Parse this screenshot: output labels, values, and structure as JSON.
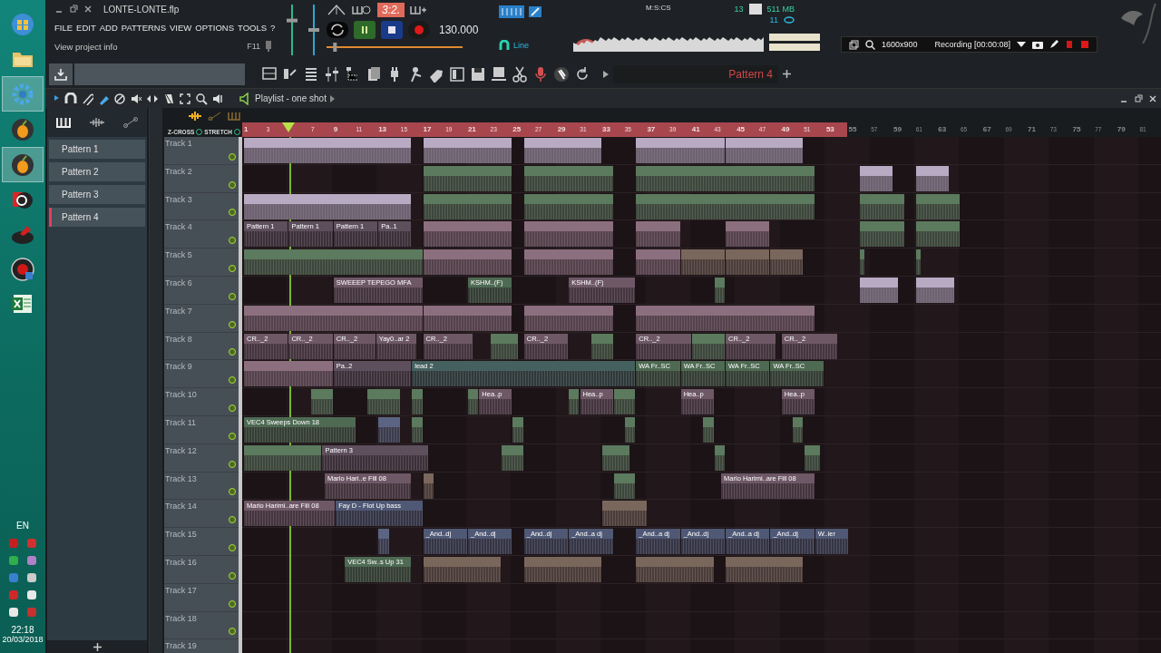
{
  "taskbar": {
    "language": "EN",
    "time": "22:18",
    "date": "20/03/2018"
  },
  "window": {
    "title": "LONTE-LONTE.flp"
  },
  "menu": [
    "FILE",
    "EDIT",
    "ADD",
    "PATTERNS",
    "VIEW",
    "OPTIONS",
    "TOOLS",
    "?"
  ],
  "hint": {
    "text": "View project info",
    "shortcut": "F11"
  },
  "mixer": {
    "volume": {
      "level": 0.7
    },
    "pitch": {
      "level": 0.5
    }
  },
  "transport": {
    "song_position": "3:2.",
    "playing": true,
    "tempo": "130.000",
    "snap": "Line",
    "position_slider": {
      "level": 0.05
    }
  },
  "monitor": {
    "time_format": "M:S:CS",
    "cpu": "13",
    "memory": "511 MB",
    "polyphony": "11"
  },
  "pattern_selector": {
    "value": "Pattern 4"
  },
  "recorder": {
    "resolution": "1600x900",
    "status": "Recording [00:00:08]"
  },
  "playlist": {
    "title": "Playlist - one shot",
    "z_cross": "Z-CROSS",
    "stretch": "STRETCH",
    "patterns": [
      {
        "label": "Pattern 1",
        "selected": false
      },
      {
        "label": "Pattern 2",
        "selected": false
      },
      {
        "label": "Pattern 3",
        "selected": false
      },
      {
        "label": "Pattern 4",
        "selected": true
      }
    ],
    "ruler": {
      "song": [
        {
          "label": "1"
        },
        {
          "label": "3"
        },
        {
          "kind": "playhead"
        },
        {
          "label": "7"
        },
        {
          "label": "9"
        },
        {
          "label": "11"
        },
        {
          "label": "13"
        },
        {
          "label": "15"
        },
        {
          "label": "17"
        },
        {
          "label": "19"
        },
        {
          "label": "21"
        },
        {
          "label": "23"
        },
        {
          "label": "25"
        },
        {
          "label": "27"
        },
        {
          "label": "29"
        },
        {
          "label": "31"
        },
        {
          "label": "33"
        },
        {
          "label": "35"
        },
        {
          "label": "37"
        },
        {
          "label": "39"
        },
        {
          "label": "41"
        },
        {
          "label": "43"
        },
        {
          "label": "45"
        },
        {
          "label": "47"
        },
        {
          "label": "49"
        },
        {
          "label": "51"
        },
        {
          "label": "53"
        }
      ],
      "after": [
        {
          "label": "55"
        },
        {
          "label": "57"
        },
        {
          "label": "59"
        },
        {
          "label": "61"
        },
        {
          "label": "63"
        },
        {
          "label": "65"
        },
        {
          "label": "67"
        },
        {
          "label": "69"
        },
        {
          "label": "71"
        },
        {
          "label": "73"
        },
        {
          "label": "75"
        },
        {
          "label": "77"
        },
        {
          "label": "79"
        },
        {
          "label": "81"
        }
      ]
    },
    "tracks": [
      {
        "name": "Track 1",
        "enabled": true,
        "clips": [
          {
            "color": "#b9aac4"
          },
          {
            "color": "#b9aac4"
          },
          {
            "color": "#b9aac4"
          },
          {
            "color": "#b9aac4"
          },
          {
            "color": "#b9aac4"
          }
        ]
      },
      {
        "name": "Track 2",
        "enabled": true,
        "clips": [
          {
            "color": "#5c7a5e"
          },
          {
            "color": "#5c7a5e"
          },
          {
            "color": "#5c7a5e"
          },
          {
            "color": "#b9aac4"
          },
          {
            "color": "#b9aac4"
          }
        ]
      },
      {
        "name": "Track 3",
        "enabled": true,
        "clips": [
          {
            "color": "#b9aac4"
          },
          {
            "color": "#5c7a5e"
          },
          {
            "color": "#5c7a5e"
          },
          {
            "color": "#5c7a5e"
          },
          {
            "color": "#5c7a5e"
          },
          {
            "color": "#5c7a5e"
          }
        ]
      },
      {
        "name": "Track 4",
        "enabled": true,
        "clips": [
          {
            "color": "#5e4f5d",
            "label": "Pattern 1"
          },
          {
            "color": "#5e4f5d",
            "label": "Pattern 1"
          },
          {
            "color": "#5e4f5d",
            "label": "Pattern 1"
          },
          {
            "color": "#5e4f5d",
            "label": "Pa..1"
          },
          {
            "color": "#8c6f7e"
          },
          {
            "color": "#8c6f7e"
          },
          {
            "color": "#8c6f7e"
          },
          {
            "color": "#8c6f7e"
          },
          {
            "color": "#5c7a5e"
          },
          {
            "color": "#5c7a5e"
          }
        ]
      },
      {
        "name": "Track 5",
        "enabled": true,
        "clips": [
          {
            "color": "#5c7a5e"
          },
          {
            "color": "#8c6f7e"
          },
          {
            "color": "#8c6f7e"
          },
          {
            "color": "#8c6f7e"
          },
          {
            "color": "#7a675c"
          },
          {
            "color": "#7a675c"
          },
          {
            "color": "#7a675c"
          },
          {
            "color": "#5c7a5e"
          },
          {
            "color": "#5c7a5e"
          }
        ]
      },
      {
        "name": "Track 6",
        "enabled": true,
        "clips": [
          {
            "color": "#6e5866",
            "label": "SWEEEP TEPEGO MFA"
          },
          {
            "color": "#4e6a53",
            "label": "KSHM..(F)"
          },
          {
            "color": "#6e5866",
            "label": "KSHM..(F)"
          },
          {
            "color": "#5c7a5e"
          },
          {
            "color": "#b9aac4"
          },
          {
            "color": "#b9aac4"
          }
        ]
      },
      {
        "name": "Track 7",
        "enabled": true,
        "clips": [
          {
            "color": "#8c6f7e"
          },
          {
            "color": "#8c6f7e"
          },
          {
            "color": "#8c6f7e"
          },
          {
            "color": "#8c6f7e"
          }
        ]
      },
      {
        "name": "Track 8",
        "enabled": true,
        "clips": [
          {
            "color": "#6e5866",
            "label": "CR.._2"
          },
          {
            "color": "#6e5866",
            "label": "CR.._2"
          },
          {
            "color": "#6e5866",
            "label": "CR.._2"
          },
          {
            "color": "#6e5866",
            "label": "Yay0..ar 2"
          },
          {
            "color": "#6e5866",
            "label": "CR.._2"
          },
          {
            "color": "#5c7a5e"
          },
          {
            "color": "#6e5866",
            "label": "CR.._2"
          },
          {
            "color": "#5c7a5e"
          },
          {
            "color": "#6e5866",
            "label": "CR.._2"
          },
          {
            "color": "#5c7a5e"
          },
          {
            "color": "#6e5866",
            "label": "CR.._2"
          },
          {
            "color": "#6e5866",
            "label": "CR.._2"
          }
        ]
      },
      {
        "name": "Track 9",
        "enabled": true,
        "clips": [
          {
            "color": "#8c6f7e"
          },
          {
            "color": "#5e4f5d",
            "label": "Pa..2"
          },
          {
            "color": "#44605f",
            "label": "lead 2"
          },
          {
            "color": "#4e6a53",
            "label": "WA Fr..SC"
          },
          {
            "color": "#4e6a53",
            "label": "WA Fr..SC"
          },
          {
            "color": "#4e6a53",
            "label": "WA Fr..SC"
          },
          {
            "color": "#4e6a53",
            "label": "WA Fr..SC"
          }
        ]
      },
      {
        "name": "Track 10",
        "enabled": true,
        "clips": [
          {
            "color": "#5c7a5e"
          },
          {
            "color": "#5c7a5e"
          },
          {
            "color": "#5c7a5e"
          },
          {
            "color": "#5c7a5e"
          },
          {
            "color": "#6e5866",
            "label": "Hea..p"
          },
          {
            "color": "#5c7a5e"
          },
          {
            "color": "#6e5866",
            "label": "Hea..p"
          },
          {
            "color": "#5c7a5e"
          },
          {
            "color": "#6e5866",
            "label": "Hea..p"
          },
          {
            "color": "#6e5866",
            "label": "Hea..p"
          }
        ]
      },
      {
        "name": "Track 11",
        "enabled": true,
        "clips": [
          {
            "color": "#4e6a53",
            "label": "VEC4 Sweeps Down 18"
          },
          {
            "color": "#5b6583"
          },
          {
            "color": "#5c7a5e"
          },
          {
            "color": "#5c7a5e"
          },
          {
            "color": "#5c7a5e"
          },
          {
            "color": "#5c7a5e"
          },
          {
            "color": "#5c7a5e"
          }
        ]
      },
      {
        "name": "Track 12",
        "enabled": true,
        "clips": [
          {
            "color": "#5c7a5e"
          },
          {
            "color": "#5e4f5d",
            "label": "Pattern 3"
          },
          {
            "color": "#5c7a5e"
          },
          {
            "color": "#5c7a5e"
          },
          {
            "color": "#5c7a5e"
          },
          {
            "color": "#5c7a5e"
          }
        ]
      },
      {
        "name": "Track 13",
        "enabled": true,
        "clips": [
          {
            "color": "#6e5866",
            "label": "Mario Hari..e Fill 08"
          },
          {
            "color": "#7a675c"
          },
          {
            "color": "#5c7a5e"
          },
          {
            "color": "#6e5866",
            "label": "Mario Harimi..are Fill 08"
          }
        ]
      },
      {
        "name": "Track 14",
        "enabled": true,
        "clips": [
          {
            "color": "#6e5866",
            "label": "Mario Harimi..are Fill 08"
          },
          {
            "color": "#4f5874",
            "label": "Fay D - Flot Up bass"
          },
          {
            "color": "#7a675c"
          }
        ]
      },
      {
        "name": "Track 15",
        "enabled": true,
        "clips": [
          {
            "color": "#5b6583"
          },
          {
            "color": "#4f5874",
            "label": "_And..dj"
          },
          {
            "color": "#4f5874",
            "label": "_And..dj"
          },
          {
            "color": "#4f5874",
            "label": "_And..dj"
          },
          {
            "color": "#4f5874",
            "label": "_And..a dj"
          },
          {
            "color": "#4f5874",
            "label": "_And..a dj"
          },
          {
            "color": "#4f5874",
            "label": "_And..dj"
          },
          {
            "color": "#4f5874",
            "label": "_And..a dj"
          },
          {
            "color": "#4f5874",
            "label": "_And..dj"
          },
          {
            "color": "#4f5874",
            "label": "W..ier"
          }
        ]
      },
      {
        "name": "Track 16",
        "enabled": true,
        "clips": [
          {
            "color": "#4e6a53",
            "label": "VEC4 Sw..s Up 31"
          },
          {
            "color": "#7a675c"
          },
          {
            "color": "#7a675c"
          },
          {
            "color": "#7a675c"
          },
          {
            "color": "#7a675c"
          }
        ]
      },
      {
        "name": "Track 17",
        "enabled": true
      },
      {
        "name": "Track 18",
        "enabled": true
      },
      {
        "name": "Track 19"
      }
    ]
  }
}
